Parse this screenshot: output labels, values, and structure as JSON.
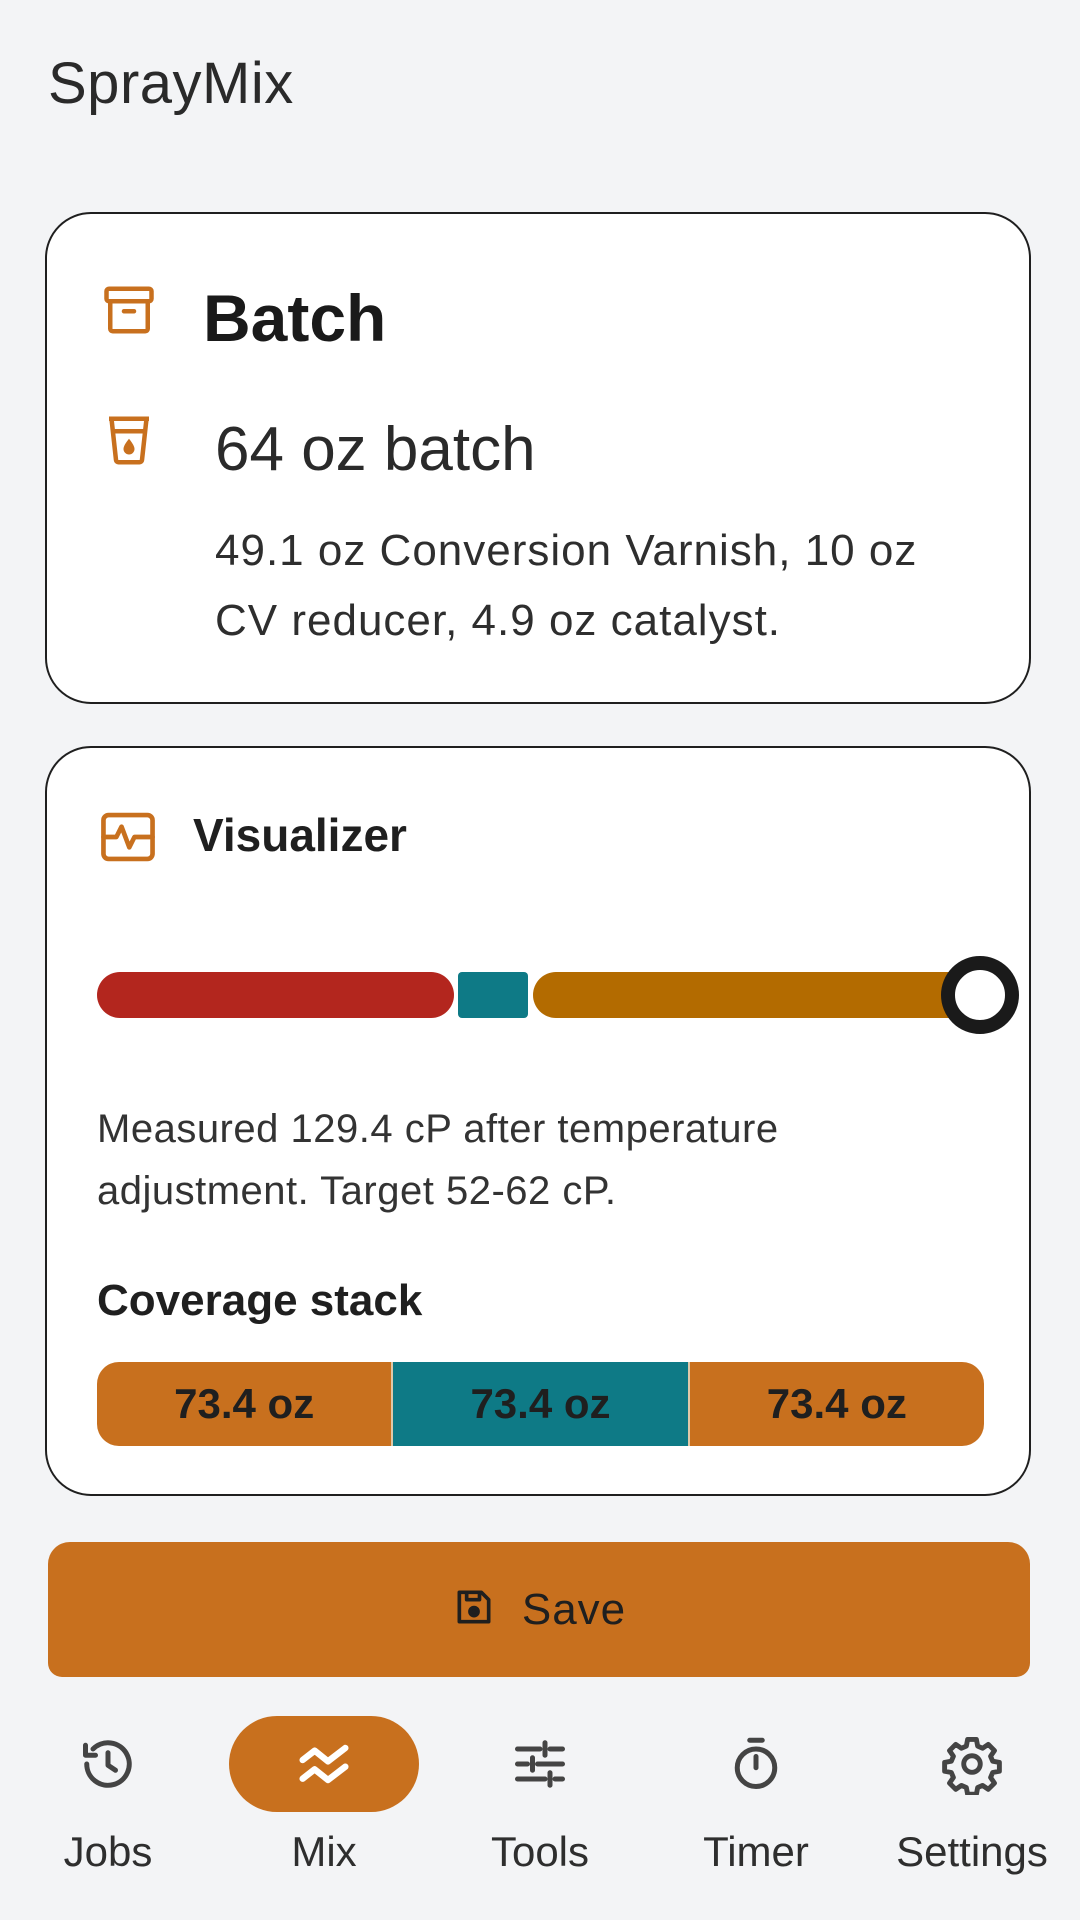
{
  "app": {
    "title": "SprayMix"
  },
  "batch": {
    "heading": "Batch",
    "amount": "64 oz batch",
    "detail": "49.1 oz Conversion Varnish, 10 oz CV reducer, 4.9 oz catalyst."
  },
  "visualizer": {
    "heading": "Visualizer",
    "zones": [
      "red",
      "teal",
      "orange"
    ],
    "level": 1.0,
    "note": "Measured 129.4 cP after temperature adjustment. Target 52-62 cP.",
    "coverage_title": "Coverage stack",
    "coverage": [
      {
        "label": "73.4 oz",
        "color": "#c8701e"
      },
      {
        "label": "73.4 oz",
        "color": "#0e7a86"
      },
      {
        "label": "73.4 oz",
        "color": "#c8701e"
      }
    ]
  },
  "actions": {
    "save_label": "Save"
  },
  "nav": {
    "items": [
      {
        "label": "Jobs",
        "icon": "history-icon",
        "active": false
      },
      {
        "label": "Mix",
        "icon": "mix-icon",
        "active": true
      },
      {
        "label": "Tools",
        "icon": "tune-icon",
        "active": false
      },
      {
        "label": "Timer",
        "icon": "timer-icon",
        "active": false
      },
      {
        "label": "Settings",
        "icon": "settings-icon",
        "active": false
      }
    ]
  },
  "colors": {
    "accent": "#c8701e",
    "teal": "#0e7a86",
    "red": "#b3261e",
    "amber": "#b36b00",
    "background": "#f3f4f6"
  }
}
